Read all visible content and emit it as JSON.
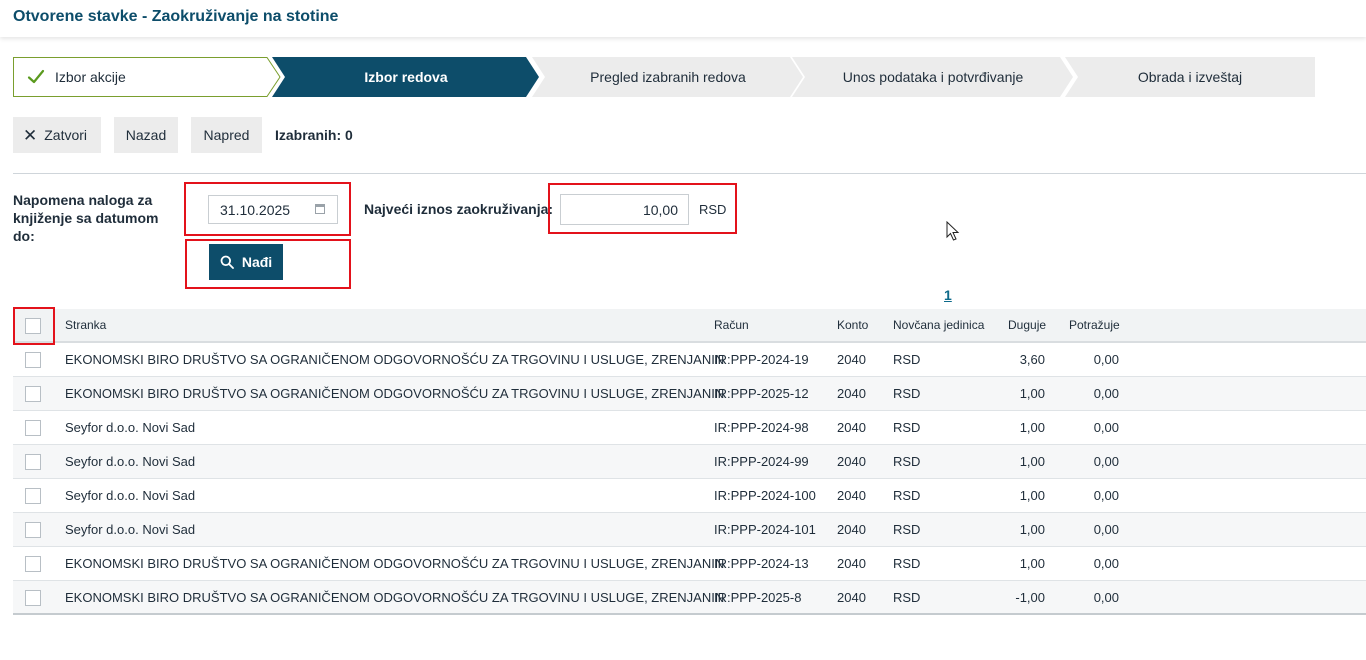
{
  "page": {
    "title": "Otvorene stavke - Zaokruživanje na stotine"
  },
  "wizard": {
    "steps": [
      {
        "label": "Izbor akcije",
        "state": "done",
        "icon": "check-icon"
      },
      {
        "label": "Izbor redova",
        "state": "active"
      },
      {
        "label": "Pregled izabranih redova",
        "state": "pending"
      },
      {
        "label": "Unos podataka i potvrđivanje",
        "state": "pending"
      },
      {
        "label": "Obrada i izveštaj",
        "state": "pending"
      }
    ],
    "colors": {
      "active": "#0d4d6a",
      "pending": "#ececec",
      "done_check": "#5a9a1e"
    }
  },
  "toolbar": {
    "close_label": "Zatvori",
    "close_icon": "close-icon",
    "back_label": "Nazad",
    "next_label": "Napred",
    "selected_label": "Izabranih: 0"
  },
  "filters": {
    "date_label": "Napomena naloga za knjiženje sa datumom do:",
    "date_value": "31.10.2025",
    "date_icon": "calendar-icon",
    "amount_label": "Najveći iznos zaokruživanja:",
    "amount_value": "10,00",
    "amount_currency": "RSD",
    "find_label": "Nađi",
    "find_icon": "search-icon",
    "highlight_color": "#e3121b"
  },
  "pager": {
    "current": "1"
  },
  "grid": {
    "columns": [
      "Stranka",
      "Račun",
      "Konto",
      "Novčana jedinica",
      "Duguje",
      "Potražuje"
    ],
    "rows": [
      {
        "party": "EKONOMSKI BIRO DRUŠTVO SA OGRANIČENOM ODGOVORNOŠĆU ZA TRGOVINU I USLUGE, ZRENJANIN",
        "invoice": "IR:PPP-2024-19",
        "account": "2040",
        "currency": "RSD",
        "debit": "3,60",
        "credit": "0,00"
      },
      {
        "party": "EKONOMSKI BIRO DRUŠTVO SA OGRANIČENOM ODGOVORNOŠĆU ZA TRGOVINU I USLUGE, ZRENJANIN",
        "invoice": "IR:PPP-2025-12",
        "account": "2040",
        "currency": "RSD",
        "debit": "1,00",
        "credit": "0,00"
      },
      {
        "party": "Seyfor d.o.o. Novi Sad",
        "invoice": "IR:PPP-2024-98",
        "account": "2040",
        "currency": "RSD",
        "debit": "1,00",
        "credit": "0,00"
      },
      {
        "party": "Seyfor d.o.o. Novi Sad",
        "invoice": "IR:PPP-2024-99",
        "account": "2040",
        "currency": "RSD",
        "debit": "1,00",
        "credit": "0,00"
      },
      {
        "party": "Seyfor d.o.o. Novi Sad",
        "invoice": "IR:PPP-2024-100",
        "account": "2040",
        "currency": "RSD",
        "debit": "1,00",
        "credit": "0,00"
      },
      {
        "party": "Seyfor d.o.o. Novi Sad",
        "invoice": "IR:PPP-2024-101",
        "account": "2040",
        "currency": "RSD",
        "debit": "1,00",
        "credit": "0,00"
      },
      {
        "party": "EKONOMSKI BIRO DRUŠTVO SA OGRANIČENOM ODGOVORNOŠĆU ZA TRGOVINU I USLUGE, ZRENJANIN",
        "invoice": "IR:PPP-2024-13",
        "account": "2040",
        "currency": "RSD",
        "debit": "1,00",
        "credit": "0,00"
      },
      {
        "party": "EKONOMSKI BIRO DRUŠTVO SA OGRANIČENOM ODGOVORNOŠĆU ZA TRGOVINU I USLUGE, ZRENJANIN",
        "invoice": "IR:PPP-2025-8",
        "account": "2040",
        "currency": "RSD",
        "debit": "-1,00",
        "credit": "0,00"
      }
    ]
  }
}
